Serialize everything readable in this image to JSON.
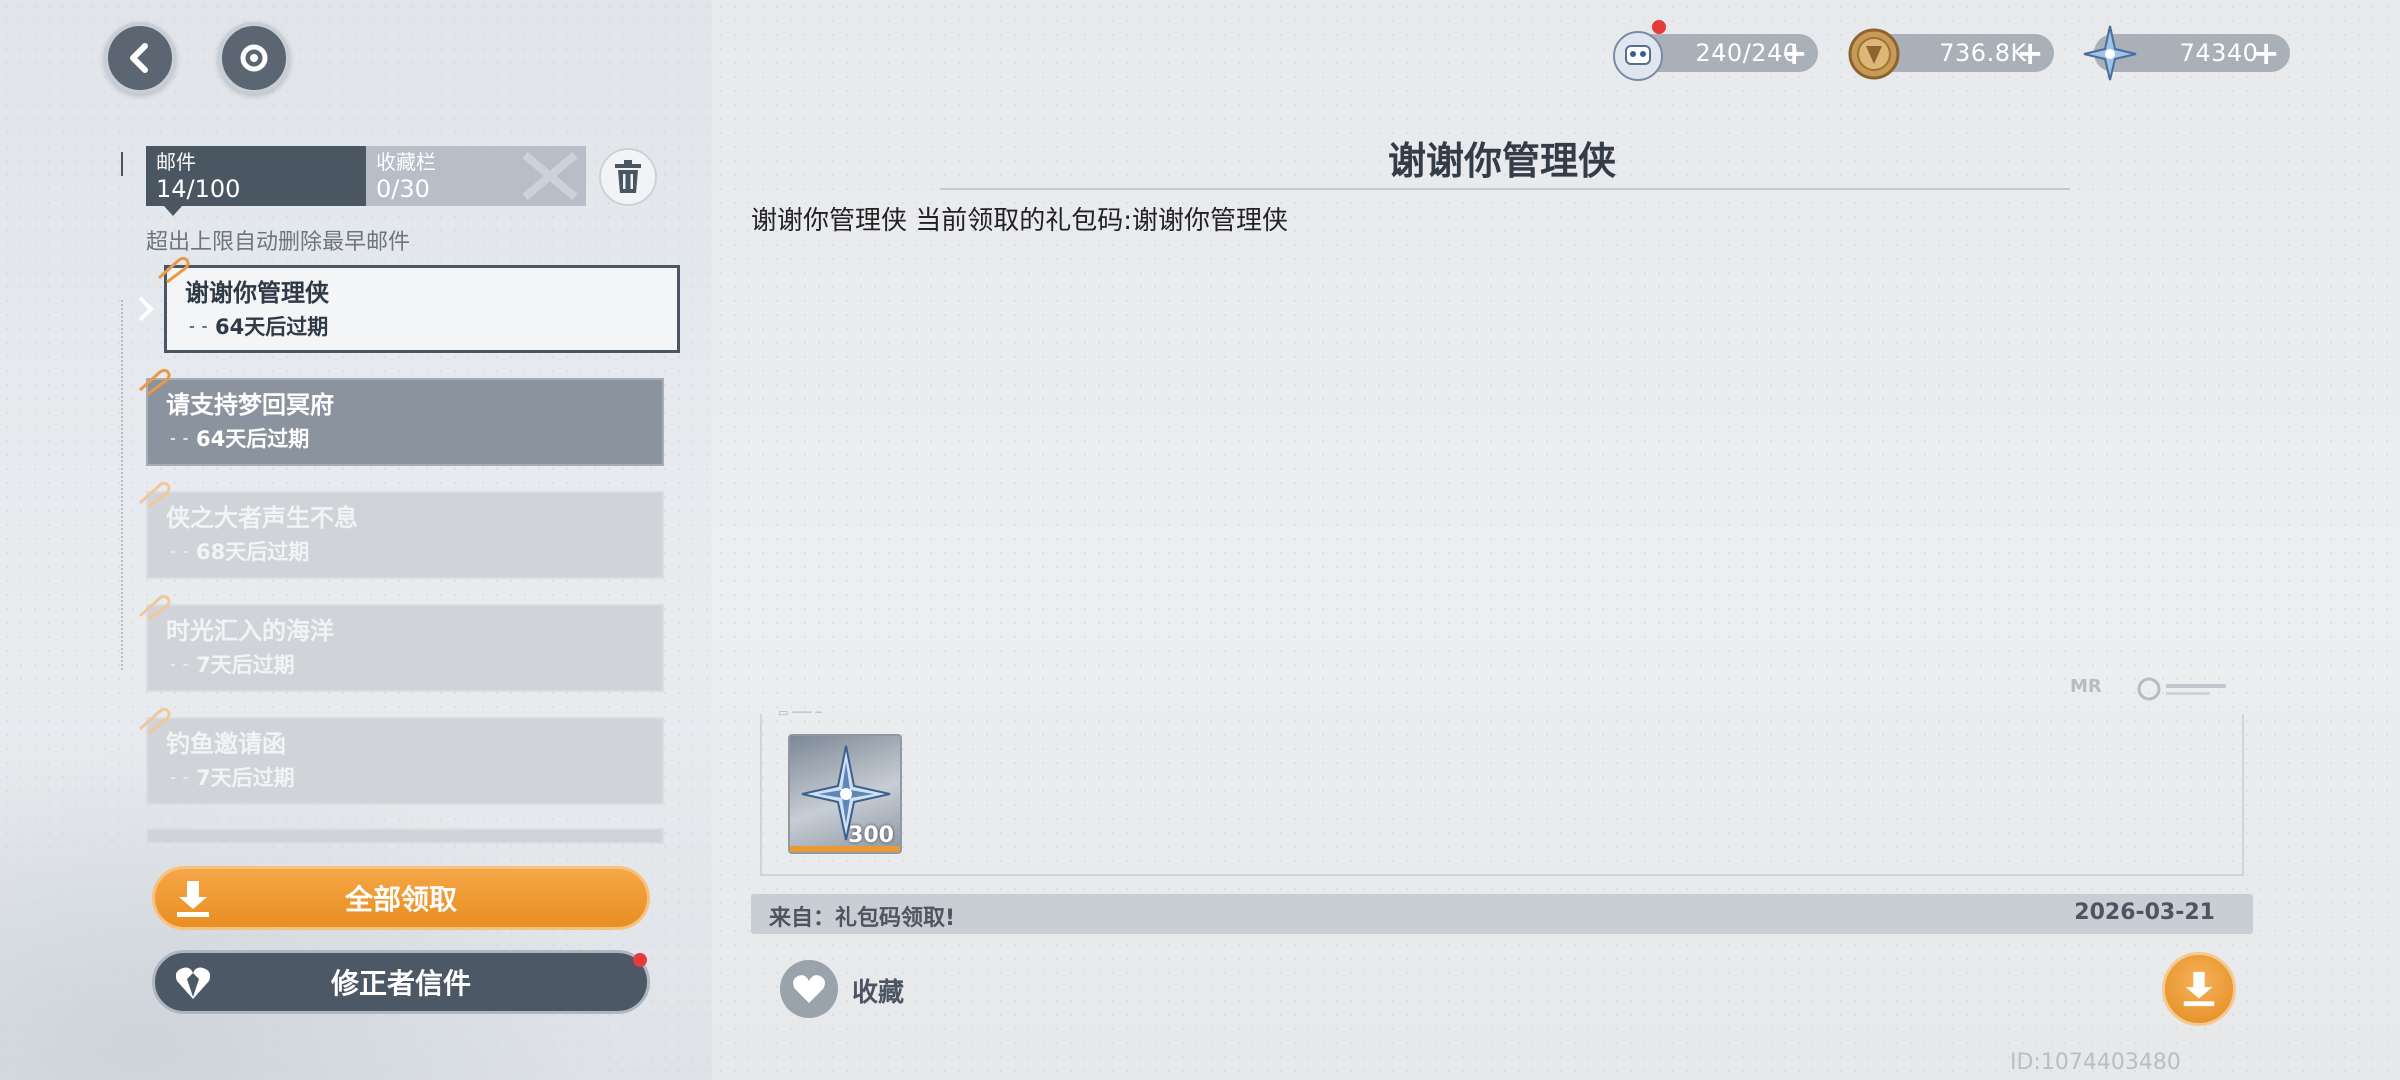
{
  "resources": [
    {
      "name": "stamina",
      "icon": "ghost-mask-icon",
      "value": "240/240",
      "has_notice": true
    },
    {
      "name": "coin",
      "icon": "coin-icon",
      "value": "736.8K",
      "has_notice": false
    },
    {
      "name": "star-crystal",
      "icon": "star-crystal-icon",
      "value": "74340",
      "has_notice": false
    }
  ],
  "plus_label": "+",
  "tabs": [
    {
      "label": "邮件",
      "count": "14/100"
    },
    {
      "label": "收藏栏",
      "count": "0/30"
    }
  ],
  "hint": "超出上限自动删除最早邮件",
  "mails": [
    {
      "subject": "谢谢你管理侠",
      "expiry": "64天后过期",
      "state": "selected"
    },
    {
      "subject": "请支持梦回冥府",
      "expiry": "64天后过期",
      "state": "unread"
    },
    {
      "subject": "侠之大者声生不息",
      "expiry": "68天后过期",
      "state": "read"
    },
    {
      "subject": "时光汇入的海洋",
      "expiry": "7天后过期",
      "state": "read"
    },
    {
      "subject": "钓鱼邀请函",
      "expiry": "7天后过期",
      "state": "read"
    }
  ],
  "buttons": {
    "claim_all": "全部领取",
    "corrector_letters": "修正者信件",
    "favorite": "收藏"
  },
  "detail": {
    "title": "谢谢你管理侠",
    "body": "谢谢你管理侠  当前领取的礼包码:谢谢你管理侠",
    "attachments": [
      {
        "icon": "star-crystal-icon",
        "quantity": "300"
      }
    ],
    "from": "来自：礼包码领取!",
    "date": "2026-03-21"
  },
  "uid": "ID:1074403480",
  "watermark": "MR",
  "colors": {
    "accent_orange": "#e88e22",
    "dark_slate": "#4b5663",
    "notice_red": "#e83a3a"
  }
}
